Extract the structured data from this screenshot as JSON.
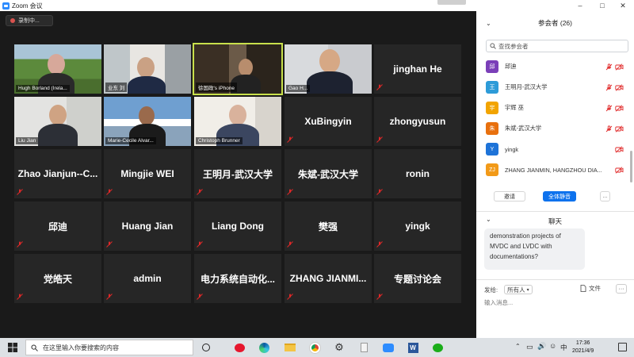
{
  "window": {
    "title": "Zoom 会议"
  },
  "recording": {
    "label": "录制中..."
  },
  "tiles": [
    {
      "name": "Hugh Borland (Irela...",
      "type": "video"
    },
    {
      "name": "业东 刘",
      "type": "video"
    },
    {
      "name": "徐国政's iPhone",
      "type": "video"
    },
    {
      "name": "Gao H...",
      "type": "video"
    },
    {
      "name": "jinghan He",
      "type": "name"
    },
    {
      "name": "Liu Jian",
      "type": "video"
    },
    {
      "name": "Marie-Cecile Alvar...",
      "type": "video"
    },
    {
      "name": "Christoph Brunner",
      "type": "video"
    },
    {
      "name": "XuBingyin",
      "type": "name"
    },
    {
      "name": "zhongyusun",
      "type": "name"
    },
    {
      "name": "Zhao  Jianjun--C...",
      "type": "name"
    },
    {
      "name": "Mingjie WEI",
      "type": "name"
    },
    {
      "name": "王明月-武汉大学",
      "type": "name"
    },
    {
      "name": "朱斌-武汉大学",
      "type": "name"
    },
    {
      "name": "ronin",
      "type": "name"
    },
    {
      "name": "邱迪",
      "type": "name"
    },
    {
      "name": "Huang Jian",
      "type": "name"
    },
    {
      "name": "Liang Dong",
      "type": "name"
    },
    {
      "name": "樊强",
      "type": "name"
    },
    {
      "name": "yingk",
      "type": "name"
    },
    {
      "name": "党皓天",
      "type": "name"
    },
    {
      "name": "admin",
      "type": "name"
    },
    {
      "name": "电力系统自动化...",
      "type": "name"
    },
    {
      "name": "ZHANG  JIANMI...",
      "type": "name"
    },
    {
      "name": "专题讨论会",
      "type": "name"
    }
  ],
  "participants": {
    "header": "参会者 (26)",
    "search_placeholder": "查找参会者",
    "items": [
      {
        "initial": "邱",
        "name": "邱迪",
        "color": "#7b3fb8",
        "muted": true
      },
      {
        "initial": "王",
        "name": "王明月-武汉大学",
        "color": "#2d9bd8",
        "muted": true
      },
      {
        "initial": "宇",
        "name": "宇辉 巫",
        "color": "#f2a400",
        "muted": true
      },
      {
        "initial": "朱",
        "name": "朱斌-武汉大学",
        "color": "#e8700e",
        "muted": true
      },
      {
        "initial": "Y",
        "name": "yingk",
        "color": "#1e73d8",
        "muted": false
      },
      {
        "initial": "ZJ",
        "name": "ZHANG JIANMIN, HANGZHOU DIA...",
        "color": "#f29a18",
        "muted": false
      }
    ],
    "invite_label": "邀请",
    "mute_all_label": "全体静音",
    "more_label": "..."
  },
  "chat": {
    "header": "聊天",
    "message_lines": [
      "demonstration projects of",
      "MVDC and LVDC with",
      "documentations?"
    ],
    "send_to_label": "发给:",
    "recipient": "所有人",
    "file_label": "文件",
    "more_label": "···",
    "input_placeholder": "输入消息..."
  },
  "taskbar": {
    "search_placeholder": "在这里输入你要搜索的内容",
    "ime": "中",
    "time": "17:36",
    "date": "2021/4/9"
  },
  "colors": {
    "accent": "#0e72ed",
    "active_speaker": "#c8e04b",
    "muted_red": "#e02828"
  }
}
